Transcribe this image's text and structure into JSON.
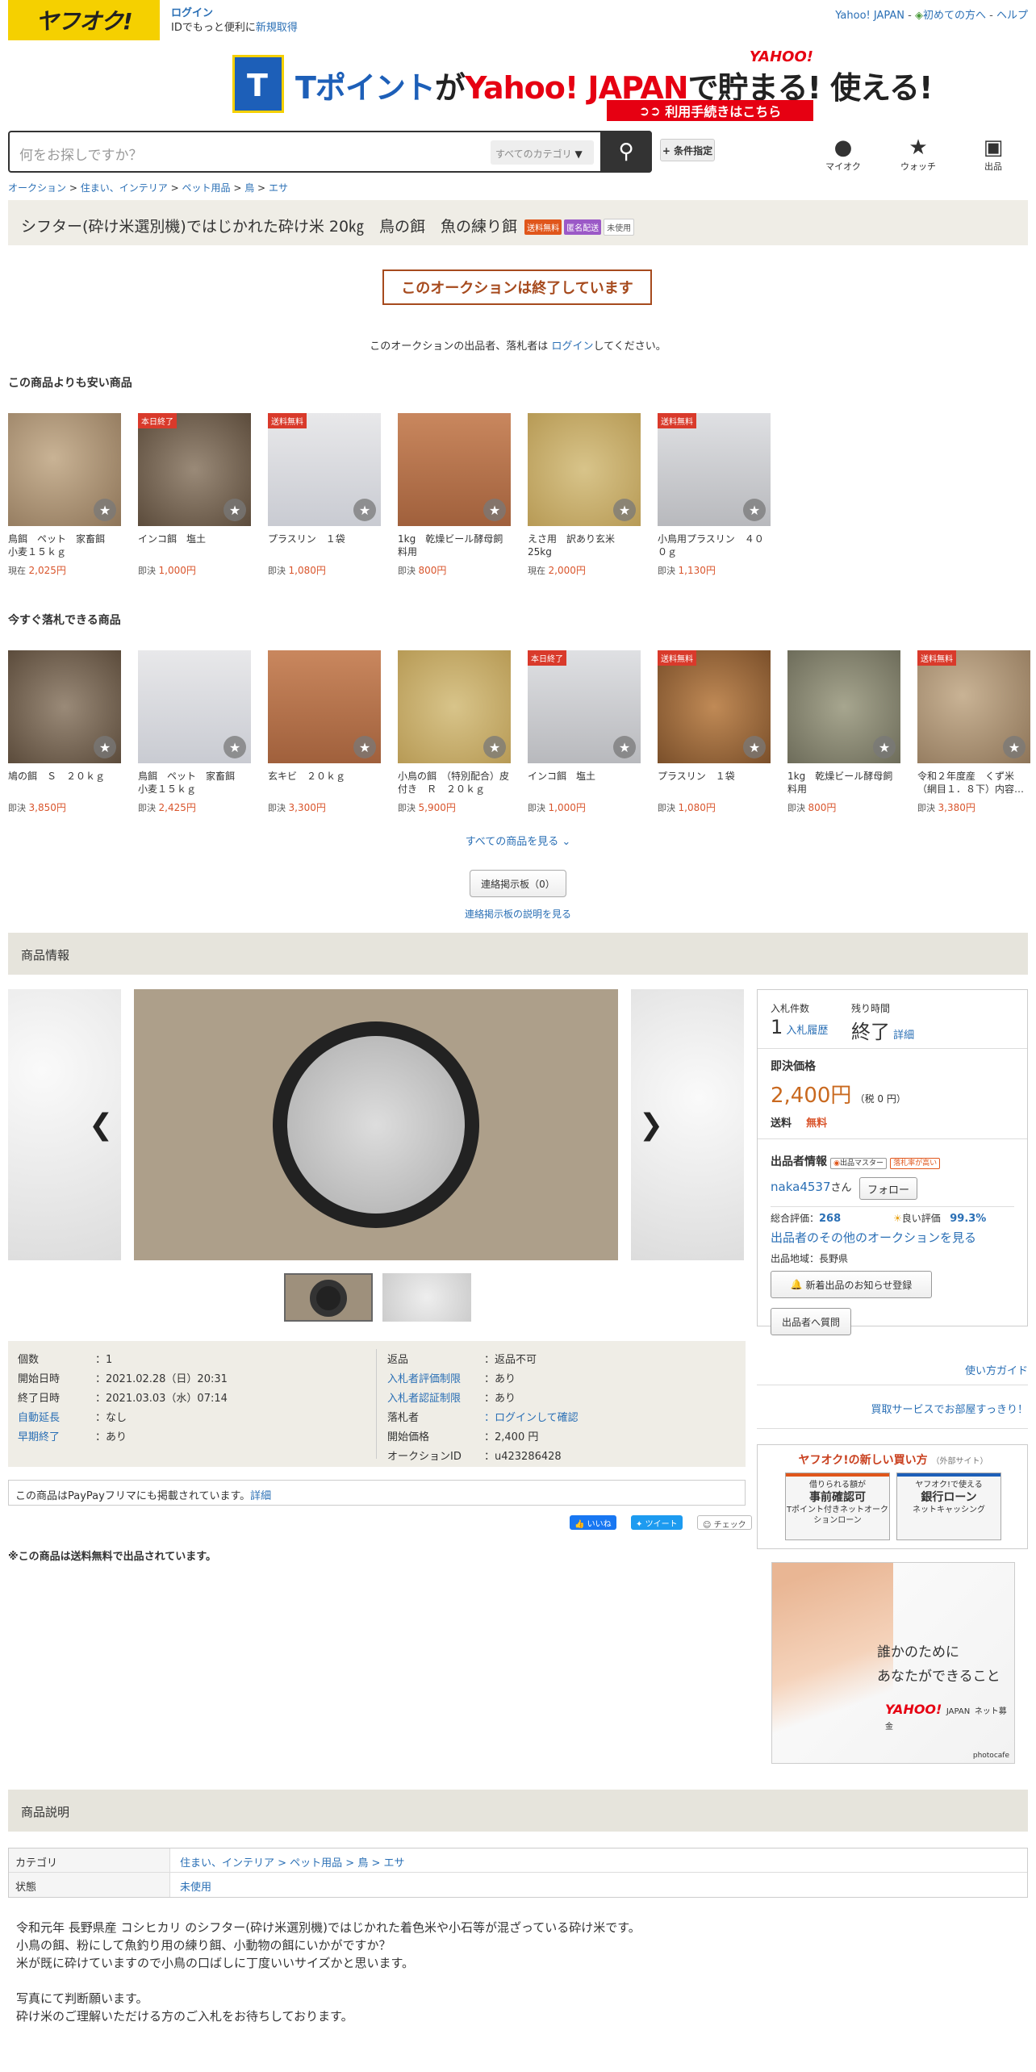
{
  "header": {
    "logo": "ヤフオク!",
    "login": "ログイン",
    "login_sub_prefix": "IDでもっと便利に",
    "signup": "新規取得",
    "yahoo_japan": "Yahoo! JAPAN",
    "first_time": "初めての方へ",
    "help": "ヘルプ",
    "sep": "-"
  },
  "banner": {
    "t_letter": "T",
    "text_part1": "Tポイント",
    "text_part2": "が",
    "text_part3": "Yahoo! JAPAN",
    "text_part4": "で",
    "text_part5": "貯まる! 使える!",
    "yahoo": "YAHOO!",
    "button": "利用手続きはこちら"
  },
  "search": {
    "placeholder": "何をお探しですか？",
    "category": "すべてのカテゴリ",
    "advanced": "+ 条件指定",
    "icons": [
      {
        "label": "マイオク",
        "icon": "person-icon"
      },
      {
        "label": "ウォッチ",
        "icon": "star-icon"
      },
      {
        "label": "出品",
        "icon": "camera-icon"
      }
    ]
  },
  "breadcrumb": [
    "オークション",
    "住まい、インテリア",
    "ペット用品",
    "鳥",
    "エサ"
  ],
  "breadcrumb_sep": ">",
  "item": {
    "title": "シフター(砕け米選別機)ではじかれた砕け米 20㎏　鳥の餌　魚の練り餌",
    "tags": [
      "送料無料",
      "匿名配送",
      "未使用"
    ]
  },
  "ended": {
    "label": "このオークションは終了しています",
    "note_prefix": "このオークションの出品者、落札者は",
    "note_link": "ログイン",
    "note_suffix": "してください。"
  },
  "cheaper": {
    "heading": "この商品よりも安い商品",
    "items": [
      {
        "name": "鳥餌　ペット　家畜餌　小麦１５ｋｇ",
        "price_label": "現在",
        "price": "2,025円",
        "ribbon": ""
      },
      {
        "name": "インコ餌　塩土",
        "price_label": "即決",
        "price": "1,000円",
        "ribbon": "本日終了"
      },
      {
        "name": "プラスリン　１袋",
        "price_label": "即決",
        "price": "1,080円",
        "ribbon": "送料無料"
      },
      {
        "name": "1kg　乾燥ビール酵母飼料用",
        "price_label": "即決",
        "price": "800円",
        "ribbon": ""
      },
      {
        "name": "えさ用　訳あり玄米　25kg",
        "price_label": "現在",
        "price": "2,000円",
        "ribbon": ""
      },
      {
        "name": "小鳥用プラスリン　４００ｇ",
        "price_label": "即決",
        "price": "1,130円",
        "ribbon": "送料無料"
      }
    ]
  },
  "buynow": {
    "heading": "今すぐ落札できる商品",
    "items": [
      {
        "name": "鳩の餌　Ｓ　２０ｋｇ",
        "price_label": "即決",
        "price": "3,850円",
        "ribbon": ""
      },
      {
        "name": "鳥餌　ペット　家畜餌　小麦１５ｋｇ",
        "price_label": "即決",
        "price": "2,425円",
        "ribbon": ""
      },
      {
        "name": "玄キビ　２０ｋｇ",
        "price_label": "即決",
        "price": "3,300円",
        "ribbon": ""
      },
      {
        "name": "小鳥の餌　（特別配合）皮付き　Ｒ　２０ｋｇ",
        "price_label": "即決",
        "price": "5,900円",
        "ribbon": ""
      },
      {
        "name": "インコ餌　塩土",
        "price_label": "即決",
        "price": "1,000円",
        "ribbon": "本日終了"
      },
      {
        "name": "プラスリン　１袋",
        "price_label": "即決",
        "price": "1,080円",
        "ribbon": "送料無料"
      },
      {
        "name": "1kg　乾燥ビール酵母飼料用",
        "price_label": "即決",
        "price": "800円",
        "ribbon": ""
      },
      {
        "name": "令和２年度産　くず米（網目１．８下）内容…",
        "price_label": "即決",
        "price": "3,380円",
        "ribbon": "送料無料"
      }
    ]
  },
  "see_all": "すべての商品を見る",
  "bbs": {
    "button": "連絡掲示板（0）",
    "link": "連絡掲示板の説明を見る"
  },
  "product_info_heading": "商品情報",
  "details_left": [
    {
      "label": "個数",
      "value": "1",
      "label_link": false,
      "value_link": false
    },
    {
      "label": "開始日時",
      "value": "2021.02.28（日）20:31",
      "label_link": false,
      "value_link": false
    },
    {
      "label": "終了日時",
      "value": "2021.03.03（水）07:14",
      "label_link": false,
      "value_link": false
    },
    {
      "label": "自動延長",
      "value": "なし",
      "label_link": true,
      "value_link": false
    },
    {
      "label": "早期終了",
      "value": "あり",
      "label_link": true,
      "value_link": false
    }
  ],
  "details_right": [
    {
      "label": "返品",
      "value": "返品不可",
      "label_link": false,
      "value_link": false
    },
    {
      "label": "入札者評価制限",
      "value": "あり",
      "label_link": true,
      "value_link": false
    },
    {
      "label": "入札者認証制限",
      "value": "あり",
      "label_link": true,
      "value_link": false
    },
    {
      "label": "落札者",
      "value": "ログインして確認",
      "label_link": false,
      "value_link": true
    },
    {
      "label": "開始価格",
      "value": "2,400 円",
      "label_link": false,
      "value_link": false
    },
    {
      "label": "オークションID",
      "value": "u423286428",
      "label_link": false,
      "value_link": false
    }
  ],
  "colon": "：",
  "paypay": {
    "text": "この商品はPayPayフリマにも掲載されています。",
    "link": "詳細"
  },
  "social": {
    "like": "いいね",
    "tweet": "ツイート",
    "check": "チェック"
  },
  "free_shipping_note": "※この商品は送料無料で出品されています。",
  "panel": {
    "bids_label": "入札件数",
    "bids_value": "1",
    "bids_history": "入札履歴",
    "remaining_label": "残り時間",
    "remaining_value": "終了",
    "remaining_detail": "詳細",
    "buynow_label": "即決価格",
    "buynow_price": "2,400円",
    "buynow_tax": "（税 0 円）",
    "shipping_label": "送料",
    "shipping_value": "無料",
    "seller_heading": "出品者情報",
    "seller_badge1": "出品マスター",
    "seller_badge2": "落札率が高い",
    "seller_name": "naka4537",
    "seller_suffix": "さん",
    "follow": "フォロー",
    "rating_label": "総合評価：",
    "rating_value": "268",
    "good_label": "良い評価",
    "good_value": "99.3%",
    "other_auctions": "出品者のその他のオークションを見る",
    "region": "出品地域：長野県",
    "notify": "新着出品のお知らせ登録",
    "ask": "出品者へ質問"
  },
  "guide": "使い方ガイド",
  "buy_service": "買取サービスでお部屋すっきり！",
  "newway": {
    "title": "ヤフオク!の新しい買い方",
    "title_small": "（外部サイト）",
    "box1_top": "借りられる額が",
    "box1_main": "事前確認可",
    "box1_sub": "Tポイント付きネットオークションローン",
    "box2_top": "ヤフオク!で使える",
    "box2_main": "銀行ローン",
    "box2_sub": "ネットキャッシング"
  },
  "ad": {
    "line1": "誰かのために",
    "line2": "あなたができること",
    "brand": "YAHOO!",
    "brand_small": "JAPAN",
    "brand_tail": "ネット募金",
    "credit": "photocafe"
  },
  "description_heading": "商品説明",
  "desc_table": [
    {
      "key": "カテゴリ",
      "value": "住まい、インテリア > ペット用品 > 鳥 > エサ"
    },
    {
      "key": "状態",
      "value": "未使用"
    }
  ],
  "description_lines": [
    "令和元年 長野県産 コシヒカリ のシフター(砕け米選別機)ではじかれた着色米や小石等が混ざっている砕け米です。",
    "小鳥の餌、粉にして魚釣り用の練り餌、小動物の餌にいかがですか？",
    "米が既に砕けていますので小鳥の口ばしに丁度いいサイズかと思います。",
    "",
    "写真にて判断願います。",
    "砕け米のご理解いただける方のご入札をお待ちしております。"
  ],
  "colors": {
    "accent": "#2a6fb5",
    "price": "#d9542b",
    "brand": "#f5d000",
    "ended": "#a64a1d"
  }
}
